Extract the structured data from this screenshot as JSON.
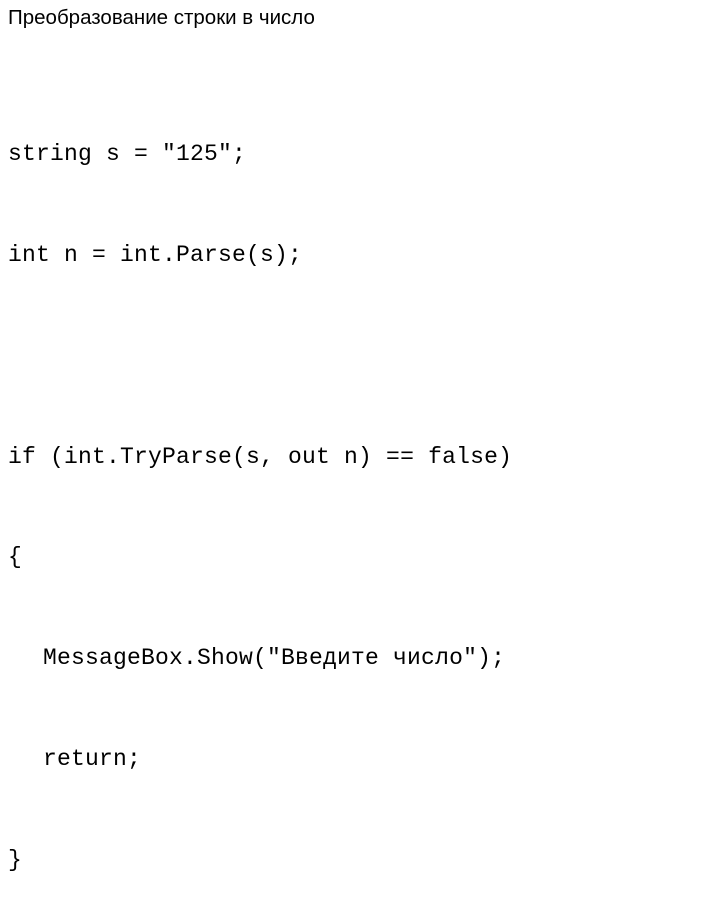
{
  "slide": {
    "title": "Преобразование строки в число",
    "code_lines": [
      {
        "text": "string s = \"125\";",
        "indent": 0
      },
      {
        "text": "int n = int.Parse(s);",
        "indent": 0
      },
      {
        "text": "",
        "indent": 0
      },
      {
        "text": "if (int.TryParse(s, out n) == false)",
        "indent": 0
      },
      {
        "text": "{",
        "indent": 0
      },
      {
        "text": "MessageBox.Show(\"Введите число\");",
        "indent": 1
      },
      {
        "text": "return;",
        "indent": 1
      },
      {
        "text": "}",
        "indent": 0
      }
    ]
  }
}
